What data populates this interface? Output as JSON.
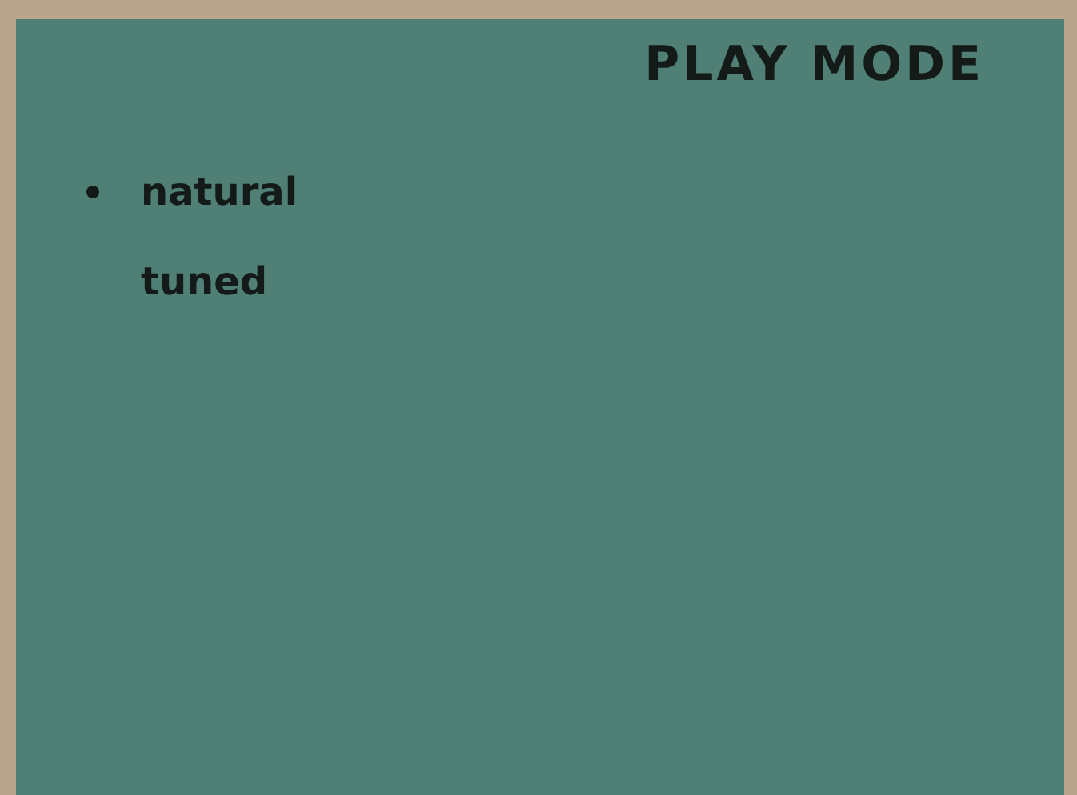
{
  "panel": {
    "title": "PLAY MODE"
  },
  "options": [
    {
      "label": "natural",
      "selected": true
    },
    {
      "label": "tuned",
      "selected": false
    }
  ]
}
